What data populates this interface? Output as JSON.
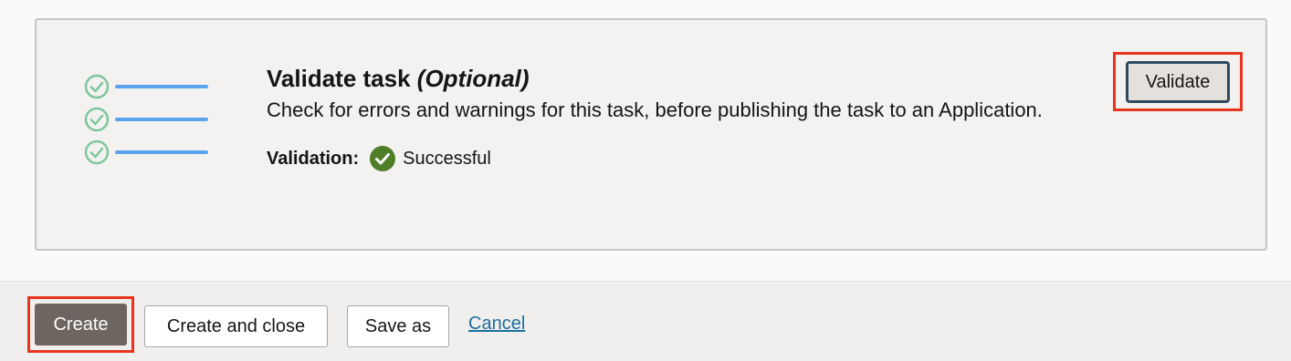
{
  "validate_card": {
    "title": "Validate task",
    "title_optional": "(Optional)",
    "description": "Check for errors and warnings for this task, before publishing the task to an Application.",
    "validation_label": "Validation:",
    "validation_status": "Successful",
    "validate_button_label": "Validate",
    "illustration_icon": "checklist-icon",
    "status_icon": "check-circle-icon"
  },
  "footer": {
    "create_label": "Create",
    "create_and_close_label": "Create and close",
    "save_as_label": "Save as",
    "cancel_label": "Cancel"
  },
  "colors": {
    "highlight": "#e8341e",
    "success": "#4f7d28",
    "checklist_check": "#7fc79a",
    "checklist_line": "#5aa3ee",
    "primary_button": "#6d6560",
    "link": "#1b6fa0"
  }
}
